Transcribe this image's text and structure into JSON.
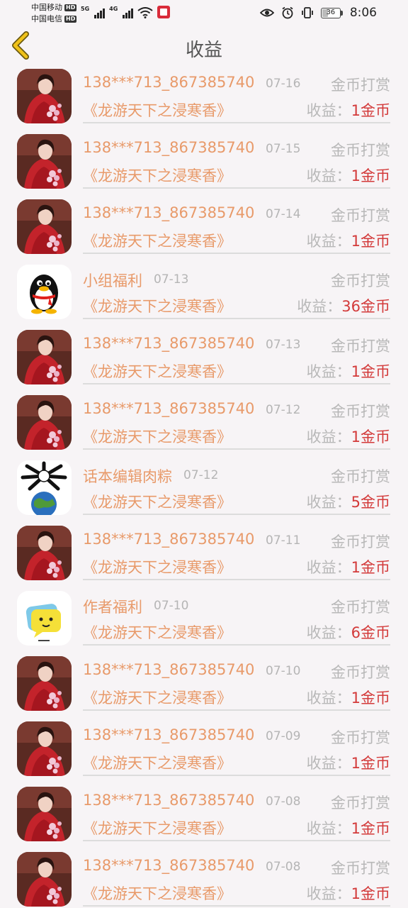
{
  "status_bar": {
    "carrier1": "中国移动",
    "carrier2": "中国电信",
    "hd": "HD",
    "net1": "5G",
    "net2": "4G",
    "battery": "36",
    "battery_level": 0.36,
    "time": "8:06"
  },
  "nav": {
    "title": "收益",
    "back_icon": "chevron-left-icon"
  },
  "earnings_label": "收益：",
  "records": [
    {
      "avatar": "woman",
      "name": "138***713_867385740",
      "date": "07-16",
      "type": "金币打赏",
      "book": "《龙游天下之浸寒香》",
      "amount": "1金币"
    },
    {
      "avatar": "woman",
      "name": "138***713_867385740",
      "date": "07-15",
      "type": "金币打赏",
      "book": "《龙游天下之浸寒香》",
      "amount": "1金币"
    },
    {
      "avatar": "woman",
      "name": "138***713_867385740",
      "date": "07-14",
      "type": "金币打赏",
      "book": "《龙游天下之浸寒香》",
      "amount": "1金币"
    },
    {
      "avatar": "penguin",
      "name": "小组福利",
      "date": "07-13",
      "type": "金币打赏",
      "book": "《龙游天下之浸寒香》",
      "amount": "36金币"
    },
    {
      "avatar": "woman",
      "name": "138***713_867385740",
      "date": "07-13",
      "type": "金币打赏",
      "book": "《龙游天下之浸寒香》",
      "amount": "1金币"
    },
    {
      "avatar": "woman",
      "name": "138***713_867385740",
      "date": "07-12",
      "type": "金币打赏",
      "book": "《龙游天下之浸寒香》",
      "amount": "1金币"
    },
    {
      "avatar": "globe",
      "name": "话本编辑肉粽",
      "date": "07-12",
      "type": "金币打赏",
      "book": "《龙游天下之浸寒香》",
      "amount": "5金币"
    },
    {
      "avatar": "woman",
      "name": "138***713_867385740",
      "date": "07-11",
      "type": "金币打赏",
      "book": "《龙游天下之浸寒香》",
      "amount": "1金币"
    },
    {
      "avatar": "bubble",
      "name": "作者福利",
      "date": "07-10",
      "type": "金币打赏",
      "book": "《龙游天下之浸寒香》",
      "amount": "6金币"
    },
    {
      "avatar": "woman",
      "name": "138***713_867385740",
      "date": "07-10",
      "type": "金币打赏",
      "book": "《龙游天下之浸寒香》",
      "amount": "1金币"
    },
    {
      "avatar": "woman",
      "name": "138***713_867385740",
      "date": "07-09",
      "type": "金币打赏",
      "book": "《龙游天下之浸寒香》",
      "amount": "1金币"
    },
    {
      "avatar": "woman",
      "name": "138***713_867385740",
      "date": "07-08",
      "type": "金币打赏",
      "book": "《龙游天下之浸寒香》",
      "amount": "1金币"
    },
    {
      "avatar": "woman",
      "name": "138***713_867385740",
      "date": "07-08",
      "type": "金币打赏",
      "book": "《龙游天下之浸寒香》",
      "amount": "1金币"
    }
  ]
}
